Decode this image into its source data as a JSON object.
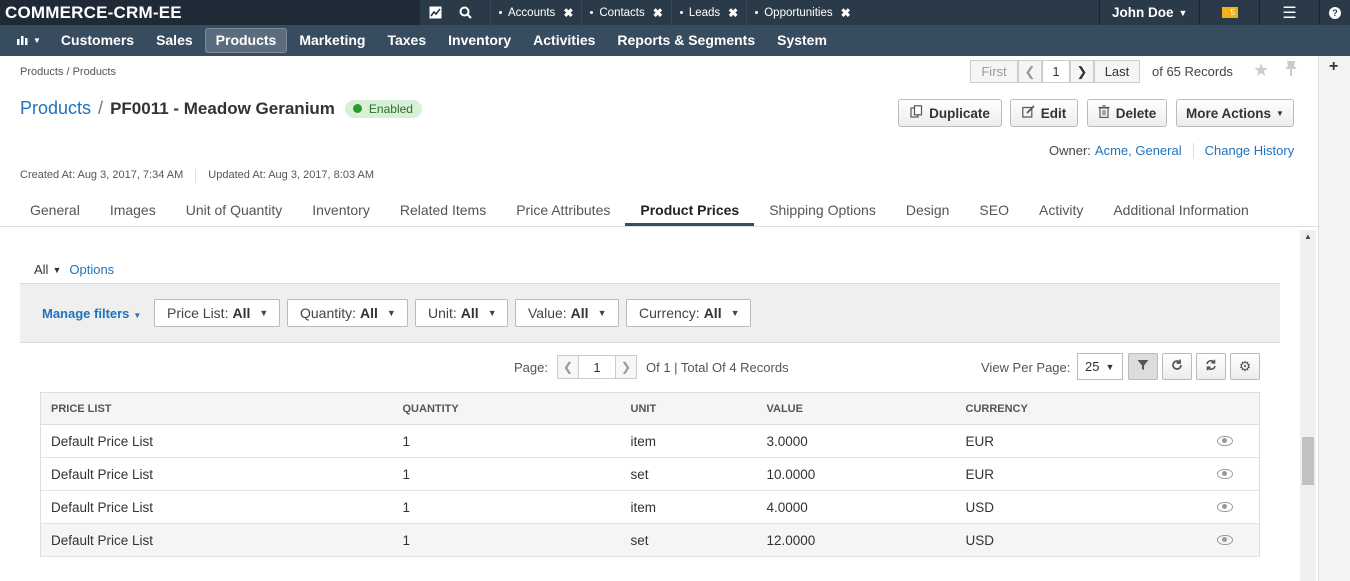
{
  "app": {
    "title": "COMMERCE-CRM-EE"
  },
  "topbar": {
    "tabs": [
      "Accounts",
      "Contacts",
      "Leads",
      "Opportunities"
    ],
    "user": "John Doe",
    "mail_count": "5"
  },
  "mainnav": {
    "items": [
      "Customers",
      "Sales",
      "Products",
      "Marketing",
      "Taxes",
      "Inventory",
      "Activities",
      "Reports & Segments",
      "System"
    ],
    "active": "Products"
  },
  "breadcrumb": "Products / Products",
  "record_pager": {
    "first": "First",
    "current": "1",
    "last": "Last",
    "total": "of 65 Records"
  },
  "header": {
    "entity": "Products",
    "separator": "/",
    "record_title": "PF0011 - Meadow Geranium",
    "status": "Enabled"
  },
  "actions": {
    "duplicate": "Duplicate",
    "edit": "Edit",
    "delete": "Delete",
    "more": "More Actions"
  },
  "owner": {
    "label": "Owner:",
    "value": "Acme, General",
    "change_history": "Change History"
  },
  "meta": {
    "created": "Created At: Aug 3, 2017, 7:34 AM",
    "updated": "Updated At: Aug 3, 2017, 8:03 AM"
  },
  "tabs": [
    "General",
    "Images",
    "Unit of Quantity",
    "Inventory",
    "Related Items",
    "Price Attributes",
    "Product Prices",
    "Shipping Options",
    "Design",
    "SEO",
    "Activity",
    "Additional Information"
  ],
  "active_tab": "Product Prices",
  "grid": {
    "view": "All",
    "options": "Options",
    "manage_filters": "Manage filters",
    "filters": [
      {
        "label": "Price List:",
        "value": "All"
      },
      {
        "label": "Quantity:",
        "value": "All"
      },
      {
        "label": "Unit:",
        "value": "All"
      },
      {
        "label": "Value:",
        "value": "All"
      },
      {
        "label": "Currency:",
        "value": "All"
      }
    ],
    "pager": {
      "page_label": "Page:",
      "page": "1",
      "summary": "Of 1 | Total Of 4 Records"
    },
    "per_page_label": "View Per Page:",
    "per_page": "25",
    "columns": [
      "PRICE LIST",
      "QUANTITY",
      "UNIT",
      "VALUE",
      "CURRENCY"
    ],
    "rows": [
      {
        "price_list": "Default Price List",
        "quantity": "1",
        "unit": "item",
        "value": "3.0000",
        "currency": "EUR"
      },
      {
        "price_list": "Default Price List",
        "quantity": "1",
        "unit": "set",
        "value": "10.0000",
        "currency": "EUR"
      },
      {
        "price_list": "Default Price List",
        "quantity": "1",
        "unit": "item",
        "value": "4.0000",
        "currency": "USD"
      },
      {
        "price_list": "Default Price List",
        "quantity": "1",
        "unit": "set",
        "value": "12.0000",
        "currency": "USD"
      }
    ]
  },
  "colors": {
    "topbar": "#2b3a48",
    "mainnav": "#384c60",
    "link": "#1e73be",
    "status_green": "#2a9b2a"
  }
}
